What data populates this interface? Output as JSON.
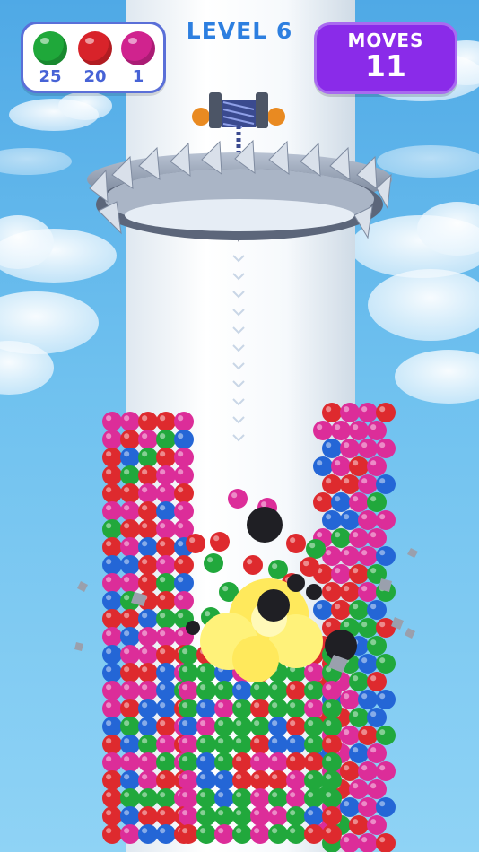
{
  "hud": {
    "level_label": "LEVEL 6",
    "moves_label": "MOVES",
    "moves_value": "11",
    "goals": [
      {
        "color_name": "green",
        "color": "#1fa83a",
        "count": "25"
      },
      {
        "color_name": "red",
        "color": "#d8232a",
        "count": "20"
      },
      {
        "color_name": "magenta",
        "color": "#d0238e",
        "count": "1"
      }
    ]
  },
  "scene": {
    "ball_colors": {
      "blue": "#2466d6",
      "red": "#de2a2e",
      "green": "#21a83c",
      "magenta": "#dc2d99",
      "black": "#1f1f24",
      "yellow": "#ffe95c"
    },
    "icons": [
      "drill-icon",
      "spiked-ring-icon",
      "spool-icon"
    ]
  }
}
